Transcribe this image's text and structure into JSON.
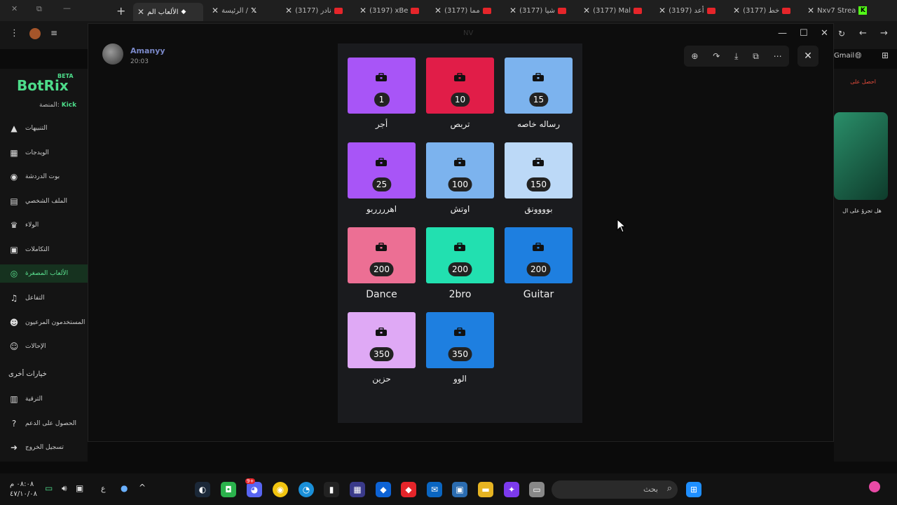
{
  "browser": {
    "tabs": [
      {
        "label": "الألعاب الم"
      },
      {
        "label": "الرئيسة /"
      },
      {
        "label": "(3177) نادر"
      },
      {
        "label": "(3197) xBe"
      },
      {
        "label": "(3177) مما"
      },
      {
        "label": "(3177) شيا"
      },
      {
        "label": "(3177) Mal"
      },
      {
        "label": "(3197) أعد"
      },
      {
        "label": "(3177) خط"
      },
      {
        "label": "Nxv7 Strea"
      }
    ],
    "gmail_label": "Gmail"
  },
  "sidebar": {
    "brand": "BotRix",
    "beta": "BETA",
    "platform_label": "المنصة:",
    "platform_value": "Kick",
    "items": [
      {
        "label": "التنبيهات",
        "icon": "warning-icon"
      },
      {
        "label": "الويدجات",
        "icon": "widgets-icon"
      },
      {
        "label": "بوت الدردشة",
        "icon": "robot-icon"
      },
      {
        "label": "الملف الشخصي",
        "icon": "profile-card-icon"
      },
      {
        "label": "الولاء",
        "icon": "trophy-icon"
      },
      {
        "label": "التكاملات",
        "icon": "integrations-icon"
      },
      {
        "label": "الألعاب المصغرة",
        "icon": "gamepad-icon",
        "active": true
      },
      {
        "label": "التفاعل",
        "icon": "music-note-icon"
      },
      {
        "label": "المستخدمون المرعيون",
        "icon": "users-icon"
      },
      {
        "label": "الإحالات",
        "icon": "referral-icon"
      }
    ],
    "other_options": "خيارات أخرى",
    "other_items": [
      {
        "label": "الترقية",
        "icon": "upgrade-icon"
      },
      {
        "label": "الحصول على الدعم",
        "icon": "help-icon"
      },
      {
        "label": "تسجيل الخروج",
        "icon": "logout-icon"
      }
    ]
  },
  "viewer": {
    "username": "Amanyy",
    "time": "20:03",
    "window_title": "NV"
  },
  "sounds": [
    {
      "name": "أجر",
      "cost": "1",
      "color": "#a855f7"
    },
    {
      "name": "تربص",
      "cost": "10",
      "color": "#e11d48"
    },
    {
      "name": "رساله خاصه",
      "cost": "15",
      "color": "#7cb3ee"
    },
    {
      "name": "اهرررربو",
      "cost": "25",
      "color": "#a855f7"
    },
    {
      "name": "اوتش",
      "cost": "100",
      "color": "#7cb3ee"
    },
    {
      "name": "بوووونق",
      "cost": "150",
      "color": "#bcd9f7"
    },
    {
      "name": "Dance",
      "cost": "200",
      "color": "#ec6f94"
    },
    {
      "name": "2bro",
      "cost": "200",
      "color": "#22e0b0"
    },
    {
      "name": "Guitar",
      "cost": "200",
      "color": "#1e7fe0"
    },
    {
      "name": "حزين",
      "cost": "350",
      "color": "#dfa9f5"
    },
    {
      "name": "الوو",
      "cost": "350",
      "color": "#1e7fe0"
    }
  ],
  "right_panel": {
    "promo": "احصل على",
    "game_text": "هل تجرؤ على ال"
  },
  "taskbar": {
    "time": "٠٨:٠٨ م",
    "date": "٤٧/١٠/٠٨",
    "lang": "ع",
    "search_placeholder": "بحث",
    "notif_count": "9+"
  }
}
